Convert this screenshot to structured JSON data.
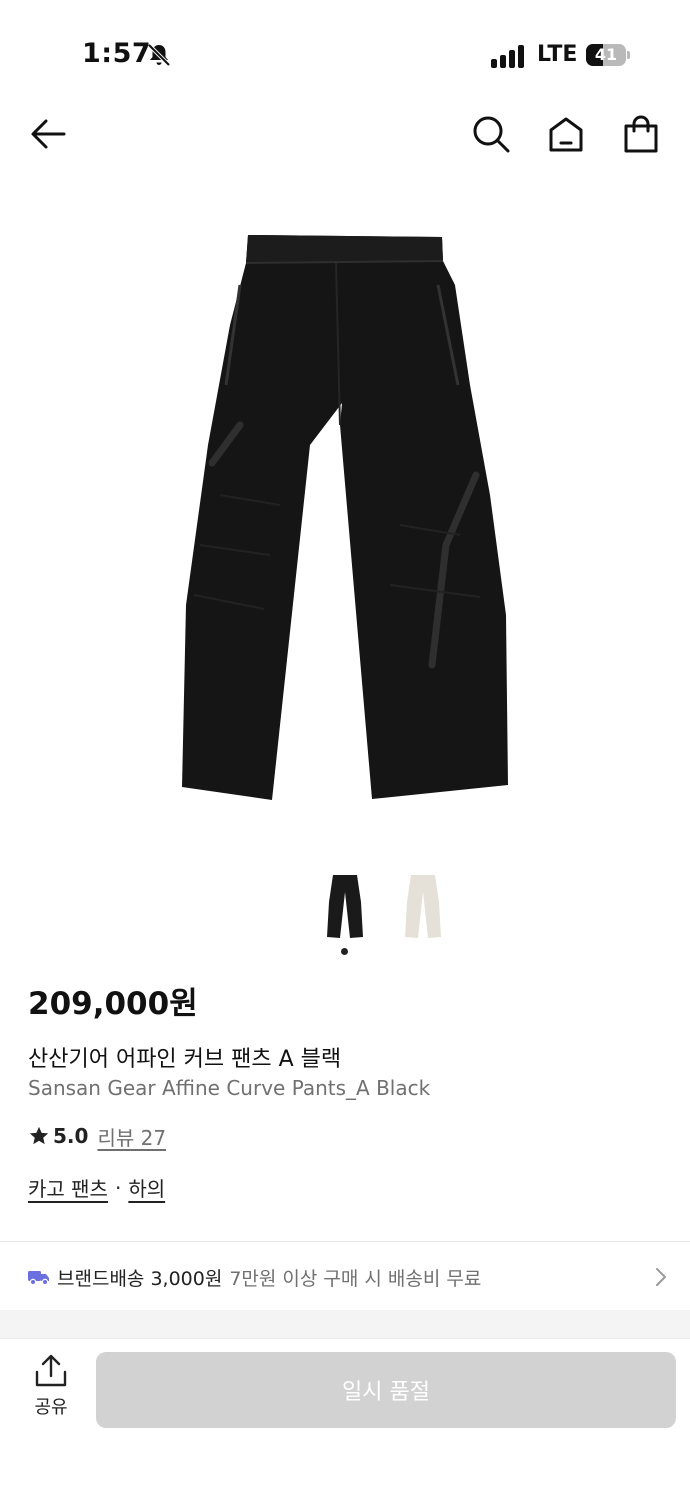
{
  "status_bar": {
    "time": "1:57",
    "network": "LTE",
    "battery": "41",
    "bell_icon": "bell-slash-icon"
  },
  "nav": {
    "back_icon": "arrow-left-icon",
    "search_icon": "search-icon",
    "home_icon": "home-icon",
    "cart_icon": "shopping-bag-icon"
  },
  "gallery": {
    "thumbnails": [
      {
        "color": "#1a1a1a",
        "label": "black"
      },
      {
        "color": "#e6e1d8",
        "label": "ivory"
      }
    ],
    "active_index": 0
  },
  "product": {
    "price": "209,000원",
    "name_ko": "산산기어 어파인 커브 팬츠 A 블랙",
    "name_en": "Sansan Gear Affine Curve Pants_A Black",
    "rating": "5.0",
    "review_label": "리뷰 27",
    "category": "카고 팬츠",
    "category_separator": "·",
    "parent_category": "하의"
  },
  "shipping": {
    "label": "브랜드배송 3,000원",
    "note": "7만원 이상 구매 시 배송비 무료",
    "icon": "truck-icon",
    "accent": "#6b6fe0"
  },
  "bottom": {
    "share_label": "공유",
    "soldout_label": "일시 품절"
  },
  "colors": {
    "pants": "#151515",
    "soldout_bg": "#d2d2d2"
  }
}
